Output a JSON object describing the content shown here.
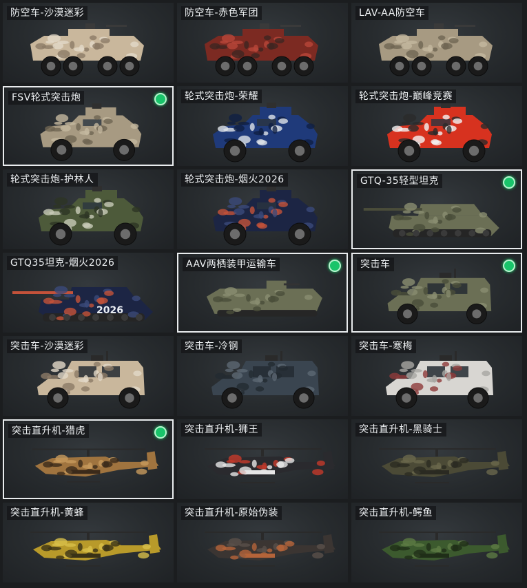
{
  "cards": [
    {
      "label": "防空车-沙漠迷彩",
      "kind": "apc",
      "camo": "desert",
      "selected": false,
      "equipped": false
    },
    {
      "label": "防空车-赤色军团",
      "kind": "apc",
      "camo": "red",
      "selected": false,
      "equipped": false
    },
    {
      "label": "LAV-AA防空车",
      "kind": "apc",
      "camo": "tan",
      "selected": false,
      "equipped": false
    },
    {
      "label": "FSV轮式突击炮",
      "kind": "fsv",
      "camo": "tan",
      "selected": true,
      "equipped": true
    },
    {
      "label": "轮式突击炮-荣耀",
      "kind": "fsv",
      "camo": "glory",
      "selected": false,
      "equipped": false
    },
    {
      "label": "轮式突击炮-巅峰竞赛",
      "kind": "fsv",
      "camo": "race",
      "selected": false,
      "equipped": false
    },
    {
      "label": "轮式突击炮-护林人",
      "kind": "fsv",
      "camo": "forest",
      "selected": false,
      "equipped": false
    },
    {
      "label": "轮式突击炮-烟火2026",
      "kind": "fsv",
      "camo": "firework",
      "selected": false,
      "equipped": false
    },
    {
      "label": "GTQ-35轻型坦克",
      "kind": "tank",
      "camo": "olive",
      "selected": true,
      "equipped": true
    },
    {
      "label": "GTQ35坦克-烟火2026",
      "kind": "tank",
      "camo": "firework",
      "selected": false,
      "equipped": false,
      "decal": "2026"
    },
    {
      "label": "AAV两栖装甲运输车",
      "kind": "aav",
      "camo": "olive",
      "selected": true,
      "equipped": true
    },
    {
      "label": "突击车",
      "kind": "mrap",
      "camo": "olive",
      "selected": true,
      "equipped": true
    },
    {
      "label": "突击车-沙漠迷彩",
      "kind": "mrap",
      "camo": "desert",
      "selected": false,
      "equipped": false
    },
    {
      "label": "突击车-冷钢",
      "kind": "mrap",
      "camo": "steel",
      "selected": false,
      "equipped": false
    },
    {
      "label": "突击车-寒梅",
      "kind": "mrap",
      "camo": "plum",
      "selected": false,
      "equipped": false
    },
    {
      "label": "突击直升机-猎虎",
      "kind": "heli",
      "camo": "tiger",
      "selected": true,
      "equipped": true
    },
    {
      "label": "突击直升机-狮王",
      "kind": "heli",
      "camo": "lion",
      "selected": false,
      "equipped": false
    },
    {
      "label": "突击直升机-黑骑士",
      "kind": "heli",
      "camo": "knight",
      "selected": false,
      "equipped": false
    },
    {
      "label": "突击直升机-黄蜂",
      "kind": "heli",
      "camo": "wasp",
      "selected": false,
      "equipped": false
    },
    {
      "label": "突击直升机-原始伪装",
      "kind": "heli",
      "camo": "primal",
      "selected": false,
      "equipped": false
    },
    {
      "label": "突击直升机-鳄鱼",
      "kind": "heli",
      "camo": "croc",
      "selected": false,
      "equipped": false
    }
  ],
  "palettes": {
    "desert": [
      "#c9b79c",
      "#8c7a66",
      "#e2d8c8"
    ],
    "red": [
      "#7c2a22",
      "#3d2622",
      "#b8463a"
    ],
    "tan": [
      "#a79a82",
      "#6f6552",
      "#c4b89f"
    ],
    "glory": [
      "#1f3a7a",
      "#dfe3e8",
      "#0f1f44"
    ],
    "race": [
      "#d7321f",
      "#f2f2f2",
      "#2a2a2a"
    ],
    "forest": [
      "#4d5a3a",
      "#c8cbb8",
      "#2d3424"
    ],
    "firework": [
      "#1c2544",
      "#c4523a",
      "#3b4a7a"
    ],
    "olive": [
      "#6b6f55",
      "#4a4d3a",
      "#8a8d70"
    ],
    "steel": [
      "#3a4550",
      "#232a31",
      "#5c6873"
    ],
    "plum": [
      "#d8d6d2",
      "#8e3b3b",
      "#a8a6a2"
    ],
    "tiger": [
      "#a0743f",
      "#3b2a1a",
      "#c79a5c"
    ],
    "lion": [
      "#2a2a2e",
      "#e6e6e6",
      "#c4392a"
    ],
    "knight": [
      "#4b4a36",
      "#2b2a22",
      "#6a684c"
    ],
    "wasp": [
      "#b89a2a",
      "#3a3216",
      "#d8bf4a"
    ],
    "primal": [
      "#3b3532",
      "#b5643a",
      "#5a504a"
    ],
    "croc": [
      "#3c5a2e",
      "#1f2e18",
      "#5d7a44"
    ]
  },
  "colors": {
    "equipped_dot": "#19c46a",
    "selected_border": "#e9ecee",
    "label_text": "#eef1f3"
  }
}
